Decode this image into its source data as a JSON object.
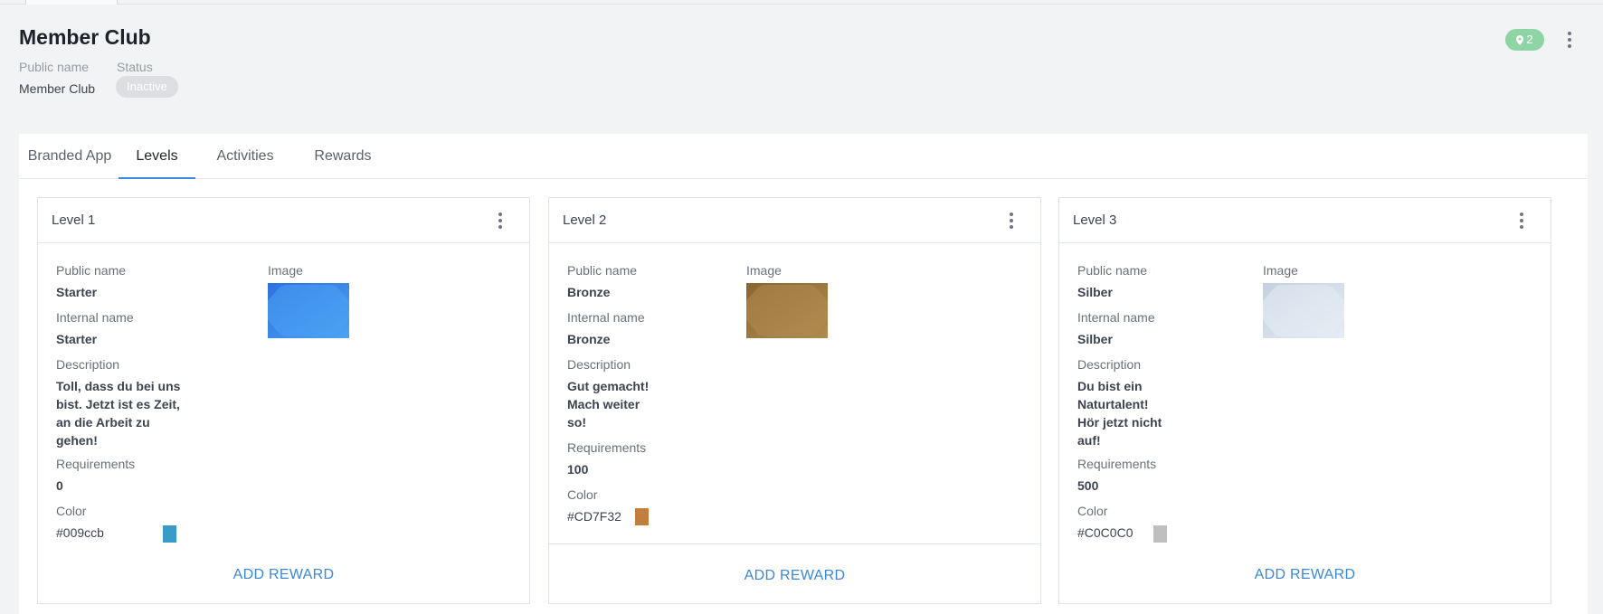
{
  "header": {
    "title": "Member Club",
    "public_name_label": "Public name",
    "status_label": "Status",
    "public_name_value": "Member Club",
    "status_value": "Inactive",
    "location_count": "2"
  },
  "tabs": [
    {
      "label": "Branded App",
      "active": false
    },
    {
      "label": "Levels",
      "active": true
    },
    {
      "label": "Activities",
      "active": false
    },
    {
      "label": "Rewards",
      "active": false
    }
  ],
  "labels": {
    "public_name": "Public name",
    "image": "Image",
    "internal_name": "Internal name",
    "description": "Description",
    "requirements": "Requirements",
    "color": "Color",
    "add_reward": "ADD REWARD"
  },
  "levels": [
    {
      "title": "Level 1",
      "public_name": "Starter",
      "internal_name": "Starter",
      "description": "Toll, dass du bei uns bist. Jetzt ist es Zeit, an die Arbeit zu gehen!",
      "requirements": "0",
      "color": "#009ccb",
      "swatch_color": "#3a9ac8",
      "image_colors": [
        "#2f6fe0",
        "#4ba3f2"
      ]
    },
    {
      "title": "Level 2",
      "public_name": "Bronze",
      "internal_name": "Bronze",
      "description": "Gut gemacht! Mach weiter so!",
      "requirements": "100",
      "color": "#CD7F32",
      "swatch_color": "#c17e3d",
      "image_colors": [
        "#8a6630",
        "#b08b50"
      ]
    },
    {
      "title": "Level 3",
      "public_name": "Silber",
      "internal_name": "Silber",
      "description": "Du bist ein Naturtalent! Hör jetzt nicht auf!",
      "requirements": "500",
      "color": "#C0C0C0",
      "swatch_color": "#bfbfbf",
      "image_colors": [
        "#c4d0e0",
        "#e6ecf4"
      ]
    }
  ]
}
